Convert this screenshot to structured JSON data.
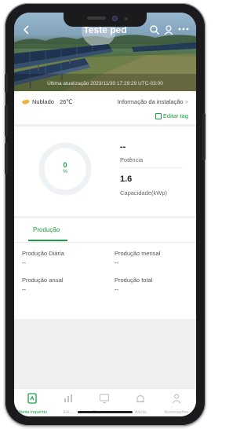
{
  "header": {
    "title": "Teste ped",
    "last_update": "Última atualização 2023/11/30 17:29:29 UTC-03:00"
  },
  "weather": {
    "condition": "Nublado",
    "temperature": "26℃"
  },
  "install_info": {
    "label": "Informação da instalação",
    "chevron": ">"
  },
  "edit_tag": "Editar tag",
  "stats": {
    "ring_value": "0",
    "ring_unit": "%",
    "power_value": "--",
    "power_label": "Potência",
    "capacity_value": "1.6",
    "capacity_label": "Capacidade(kWp)"
  },
  "production": {
    "tab_label": "Produção",
    "daily_label": "Produção Diária",
    "daily_value": "--",
    "monthly_label": "Produção mensal",
    "monthly_value": "--",
    "annual_label": "Produção anual",
    "annual_value": "--",
    "total_label": "Produção total",
    "total_value": "--"
  },
  "bottom_nav": {
    "items": [
      {
        "label": "Planta inquérito",
        "icon": "plant-icon",
        "active": true
      },
      {
        "label": "Est...",
        "icon": "stats-icon",
        "active": false
      },
      {
        "label": "Dispositivos",
        "icon": "devices-icon",
        "active": false
      },
      {
        "label": "Alerta",
        "icon": "alert-icon",
        "active": false
      },
      {
        "label": "Associações",
        "icon": "associations-icon",
        "active": false
      }
    ]
  },
  "colors": {
    "accent": "#1aa043",
    "frame": "#1b1b1d",
    "background": "#f0f0f0"
  }
}
